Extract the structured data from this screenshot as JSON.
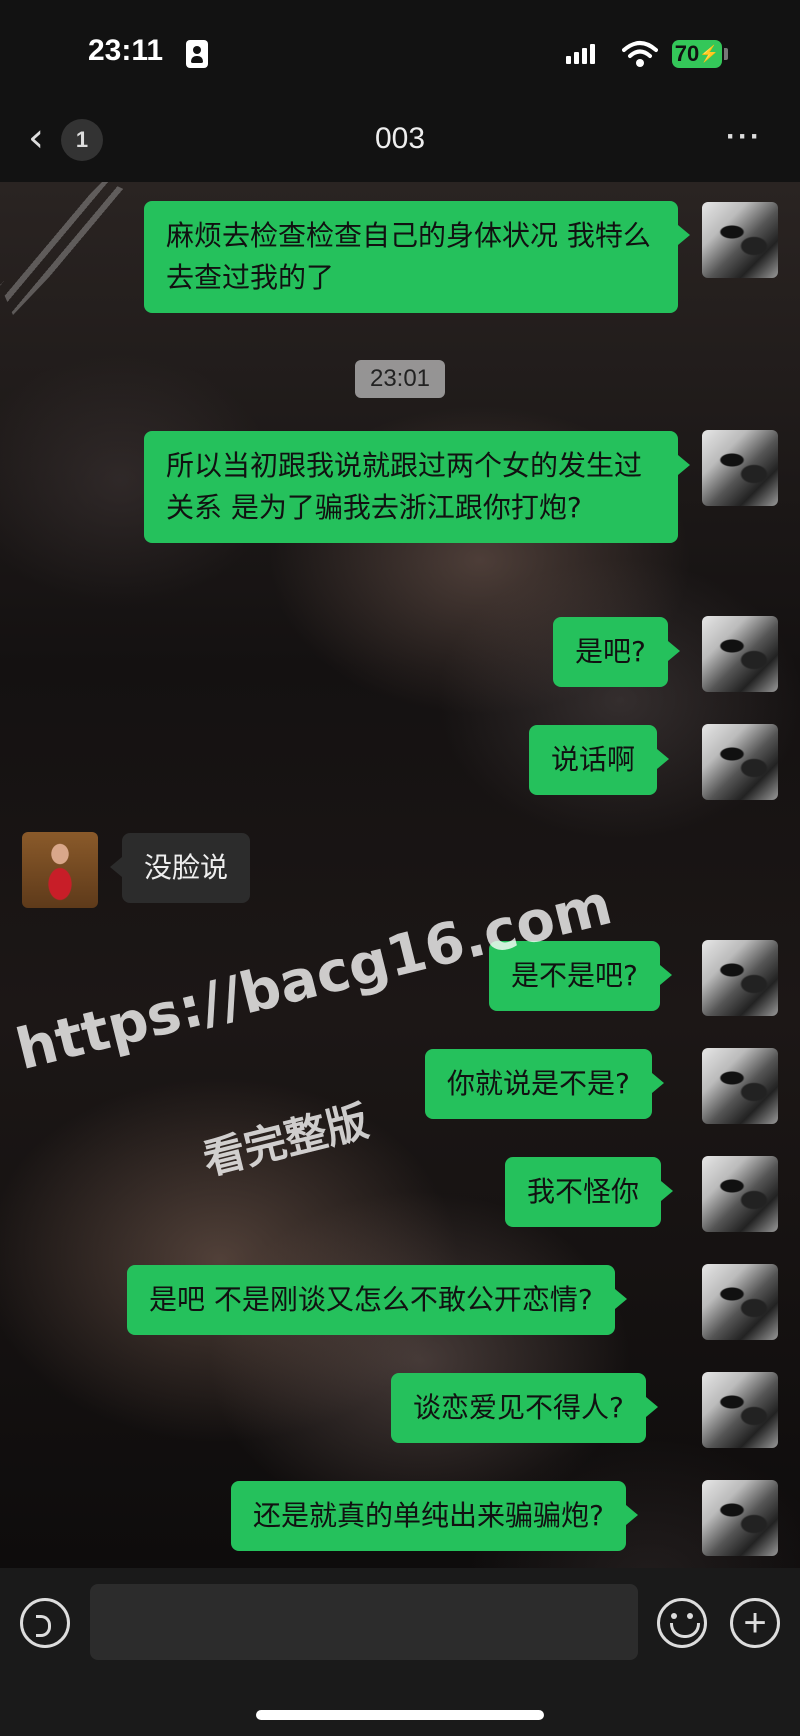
{
  "status_bar": {
    "time": "23:11",
    "battery": "70",
    "icons": [
      "id-card-icon",
      "cellular-signal-icon",
      "wifi-icon",
      "battery-charging-icon"
    ]
  },
  "header": {
    "back_glyph": "‹",
    "unread_count": "1",
    "title": "003",
    "more_glyph": "···"
  },
  "timestamp": "23:01",
  "messages": [
    {
      "side": "right",
      "text": "麻烦去检查检查自己的身体状况 我特么去查过我的了"
    },
    {
      "side": "right",
      "text": "所以当初跟我说就跟过两个女的发生过关系 是为了骗我去浙江跟你打炮?"
    },
    {
      "side": "right",
      "text": "是吧?"
    },
    {
      "side": "right",
      "text": "说话啊"
    },
    {
      "side": "left",
      "text": "没脸说"
    },
    {
      "side": "right",
      "text": "是不是吧?"
    },
    {
      "side": "right",
      "text": "你就说是不是?"
    },
    {
      "side": "right",
      "text": "我不怪你"
    },
    {
      "side": "right",
      "text": "是吧 不是刚谈又怎么不敢公开恋情?"
    },
    {
      "side": "right",
      "text": "谈恋爱见不得人?"
    },
    {
      "side": "right",
      "text": "还是就真的单纯出来骗骗炮?"
    }
  ],
  "watermark": {
    "line1": "https://bacg16.com",
    "line2": "看完整版"
  },
  "input_bar": {
    "plus_glyph": "+"
  },
  "colors": {
    "sent_bubble": "#25c15c",
    "received_bubble": "#2c2c2c",
    "battery": "#34c759"
  }
}
